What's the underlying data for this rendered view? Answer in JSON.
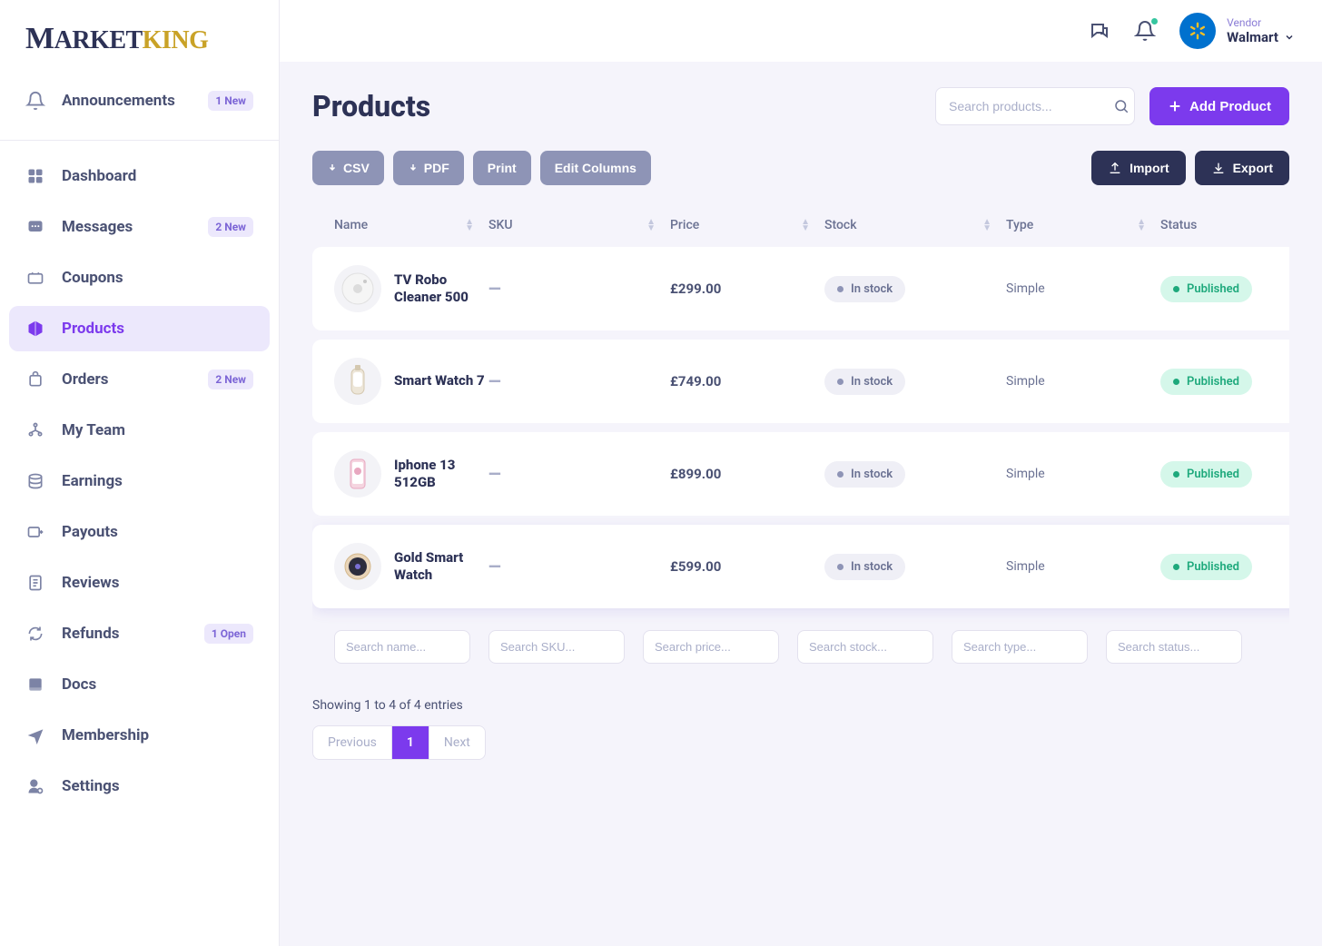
{
  "brand": {
    "part1": "M",
    "part2": "ARKET",
    "part3": "KING"
  },
  "header": {
    "vendor_label": "Vendor",
    "vendor_name": "Walmart"
  },
  "sidebar": {
    "announcements": {
      "label": "Announcements",
      "badge": "1 New"
    },
    "items": [
      {
        "label": "Dashboard",
        "badge": ""
      },
      {
        "label": "Messages",
        "badge": "2 New"
      },
      {
        "label": "Coupons",
        "badge": ""
      },
      {
        "label": "Products",
        "badge": ""
      },
      {
        "label": "Orders",
        "badge": "2 New"
      },
      {
        "label": "My Team",
        "badge": ""
      },
      {
        "label": "Earnings",
        "badge": ""
      },
      {
        "label": "Payouts",
        "badge": ""
      },
      {
        "label": "Reviews",
        "badge": ""
      },
      {
        "label": "Refunds",
        "badge": "1 Open"
      },
      {
        "label": "Docs",
        "badge": ""
      },
      {
        "label": "Membership",
        "badge": ""
      },
      {
        "label": "Settings",
        "badge": ""
      }
    ]
  },
  "page": {
    "title": "Products",
    "search_placeholder": "Search products...",
    "add_button": "Add Product"
  },
  "toolbar": {
    "csv": "CSV",
    "pdf": "PDF",
    "print": "Print",
    "edit_columns": "Edit Columns",
    "import": "Import",
    "export": "Export"
  },
  "columns": {
    "name": "Name",
    "sku": "SKU",
    "price": "Price",
    "stock": "Stock",
    "type": "Type",
    "status": "Status"
  },
  "rows": [
    {
      "name": "TV Robo Cleaner 500",
      "sku": "—",
      "price": "£299.00",
      "stock": "In stock",
      "type": "Simple",
      "status": "Published"
    },
    {
      "name": "Smart Watch 7",
      "sku": "—",
      "price": "£749.00",
      "stock": "In stock",
      "type": "Simple",
      "status": "Published"
    },
    {
      "name": "Iphone 13 512GB",
      "sku": "—",
      "price": "£899.00",
      "stock": "In stock",
      "type": "Simple",
      "status": "Published"
    },
    {
      "name": "Gold Smart Watch",
      "sku": "—",
      "price": "£599.00",
      "stock": "In stock",
      "type": "Simple",
      "status": "Published"
    }
  ],
  "filters": {
    "name": "Search name...",
    "sku": "Search SKU...",
    "price": "Search price...",
    "stock": "Search stock...",
    "type": "Search type...",
    "status": "Search status..."
  },
  "pagination": {
    "summary": "Showing 1 to 4 of 4 entries",
    "previous": "Previous",
    "current": "1",
    "next": "Next"
  }
}
